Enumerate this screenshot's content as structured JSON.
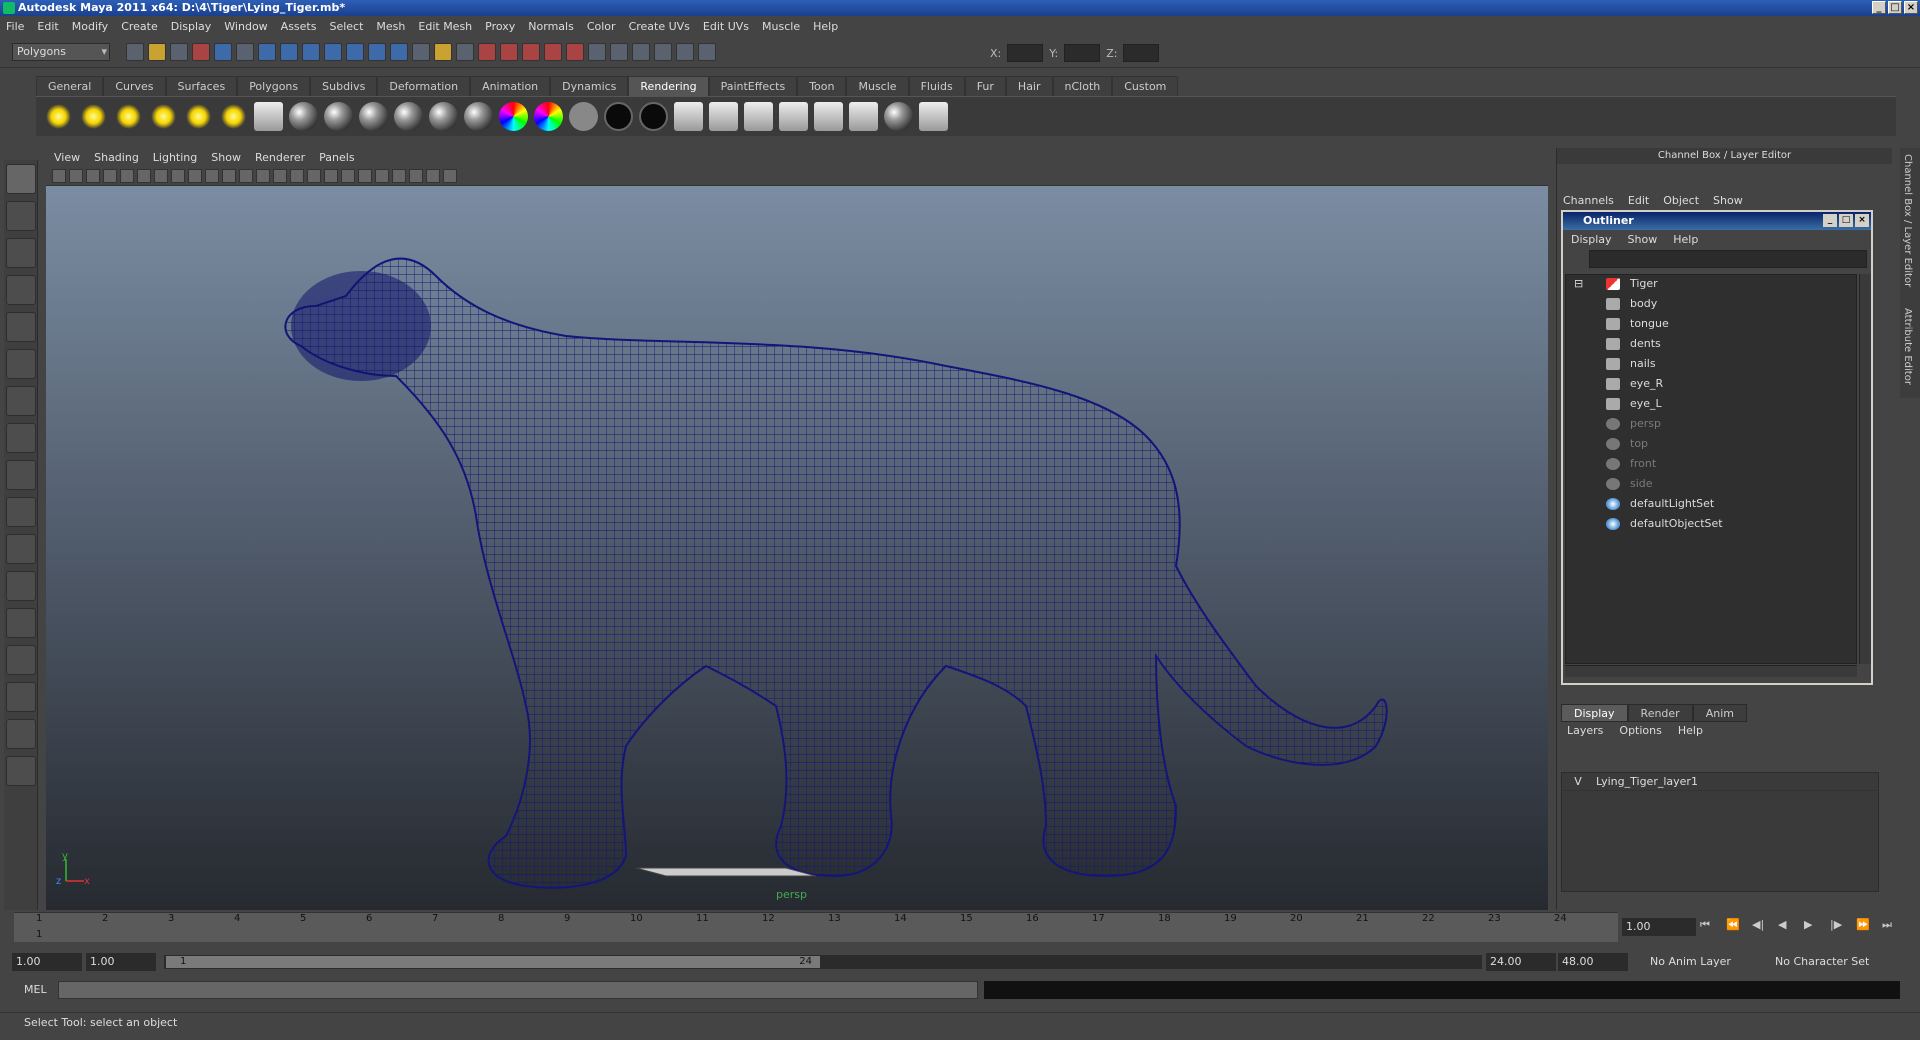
{
  "window": {
    "title": "Autodesk Maya 2011 x64: D:\\4\\Tiger\\Lying_Tiger.mb*",
    "controls": [
      "_",
      "□",
      "×"
    ]
  },
  "menubar": [
    "File",
    "Edit",
    "Modify",
    "Create",
    "Display",
    "Window",
    "Assets",
    "Select",
    "Mesh",
    "Edit Mesh",
    "Proxy",
    "Normals",
    "Color",
    "Create UVs",
    "Edit UVs",
    "Muscle",
    "Help"
  ],
  "statusline": {
    "mode": "Polygons",
    "xyz": [
      "X:",
      "Y:",
      "Z:"
    ]
  },
  "shelf": {
    "tabs": [
      "General",
      "Curves",
      "Surfaces",
      "Polygons",
      "Subdivs",
      "Deformation",
      "Animation",
      "Dynamics",
      "Rendering",
      "PaintEffects",
      "Toon",
      "Muscle",
      "Fluids",
      "Fur",
      "Hair",
      "nCloth",
      "Custom"
    ],
    "active_tab": "Rendering"
  },
  "viewport": {
    "menu": [
      "View",
      "Shading",
      "Lighting",
      "Show",
      "Renderer",
      "Panels"
    ],
    "camera": "persp",
    "axis": {
      "y": "y",
      "x": "x",
      "z": "z"
    },
    "wire_color": "#14157a"
  },
  "channelbox": {
    "title": "Channel Box / Layer Editor",
    "menu": [
      "Channels",
      "Edit",
      "Object",
      "Show"
    ]
  },
  "outliner": {
    "title": "Outliner",
    "menu": [
      "Display",
      "Show",
      "Help"
    ],
    "items": [
      {
        "label": "Tiger",
        "kind": "transform",
        "depth": 0
      },
      {
        "label": "body",
        "kind": "mesh",
        "depth": 1
      },
      {
        "label": "tongue",
        "kind": "mesh",
        "depth": 1
      },
      {
        "label": "dents",
        "kind": "mesh",
        "depth": 1
      },
      {
        "label": "nails",
        "kind": "mesh",
        "depth": 1
      },
      {
        "label": "eye_R",
        "kind": "mesh",
        "depth": 1
      },
      {
        "label": "eye_L",
        "kind": "mesh",
        "depth": 1
      },
      {
        "label": "persp",
        "kind": "camera",
        "depth": 0
      },
      {
        "label": "top",
        "kind": "camera",
        "depth": 0
      },
      {
        "label": "front",
        "kind": "camera",
        "depth": 0
      },
      {
        "label": "side",
        "kind": "camera",
        "depth": 0
      },
      {
        "label": "defaultLightSet",
        "kind": "set",
        "depth": 0
      },
      {
        "label": "defaultObjectSet",
        "kind": "set",
        "depth": 0
      }
    ]
  },
  "layers": {
    "tabs": [
      "Display",
      "Render",
      "Anim"
    ],
    "active_tab": "Display",
    "menu": [
      "Layers",
      "Options",
      "Help"
    ],
    "rows": [
      {
        "vis": "V",
        "name": "Lying_Tiger_layer1"
      }
    ]
  },
  "side_tabs": [
    "Channel Box / Layer Editor",
    "Attribute Editor"
  ],
  "timeslider": {
    "ticks": [
      "1",
      "2",
      "3",
      "4",
      "5",
      "6",
      "7",
      "8",
      "9",
      "10",
      "11",
      "12",
      "13",
      "14",
      "15",
      "16",
      "17",
      "18",
      "19",
      "20",
      "21",
      "22",
      "23",
      "24"
    ],
    "current_frame_marker": "1",
    "current_time": "1.00",
    "playback_icons": [
      "⏮",
      "⏪",
      "◀|",
      "◀",
      "▶",
      "|▶",
      "⏩",
      "⏭"
    ]
  },
  "range": {
    "start": "1.00",
    "start2": "1.00",
    "thumb_start": "1",
    "thumb_end": "24",
    "end": "24.00",
    "end2": "48.00",
    "anim_layer": "No Anim Layer",
    "char_set": "No Character Set"
  },
  "cmdline": {
    "label": "MEL"
  },
  "helpline": {
    "text": "Select Tool: select an object"
  }
}
